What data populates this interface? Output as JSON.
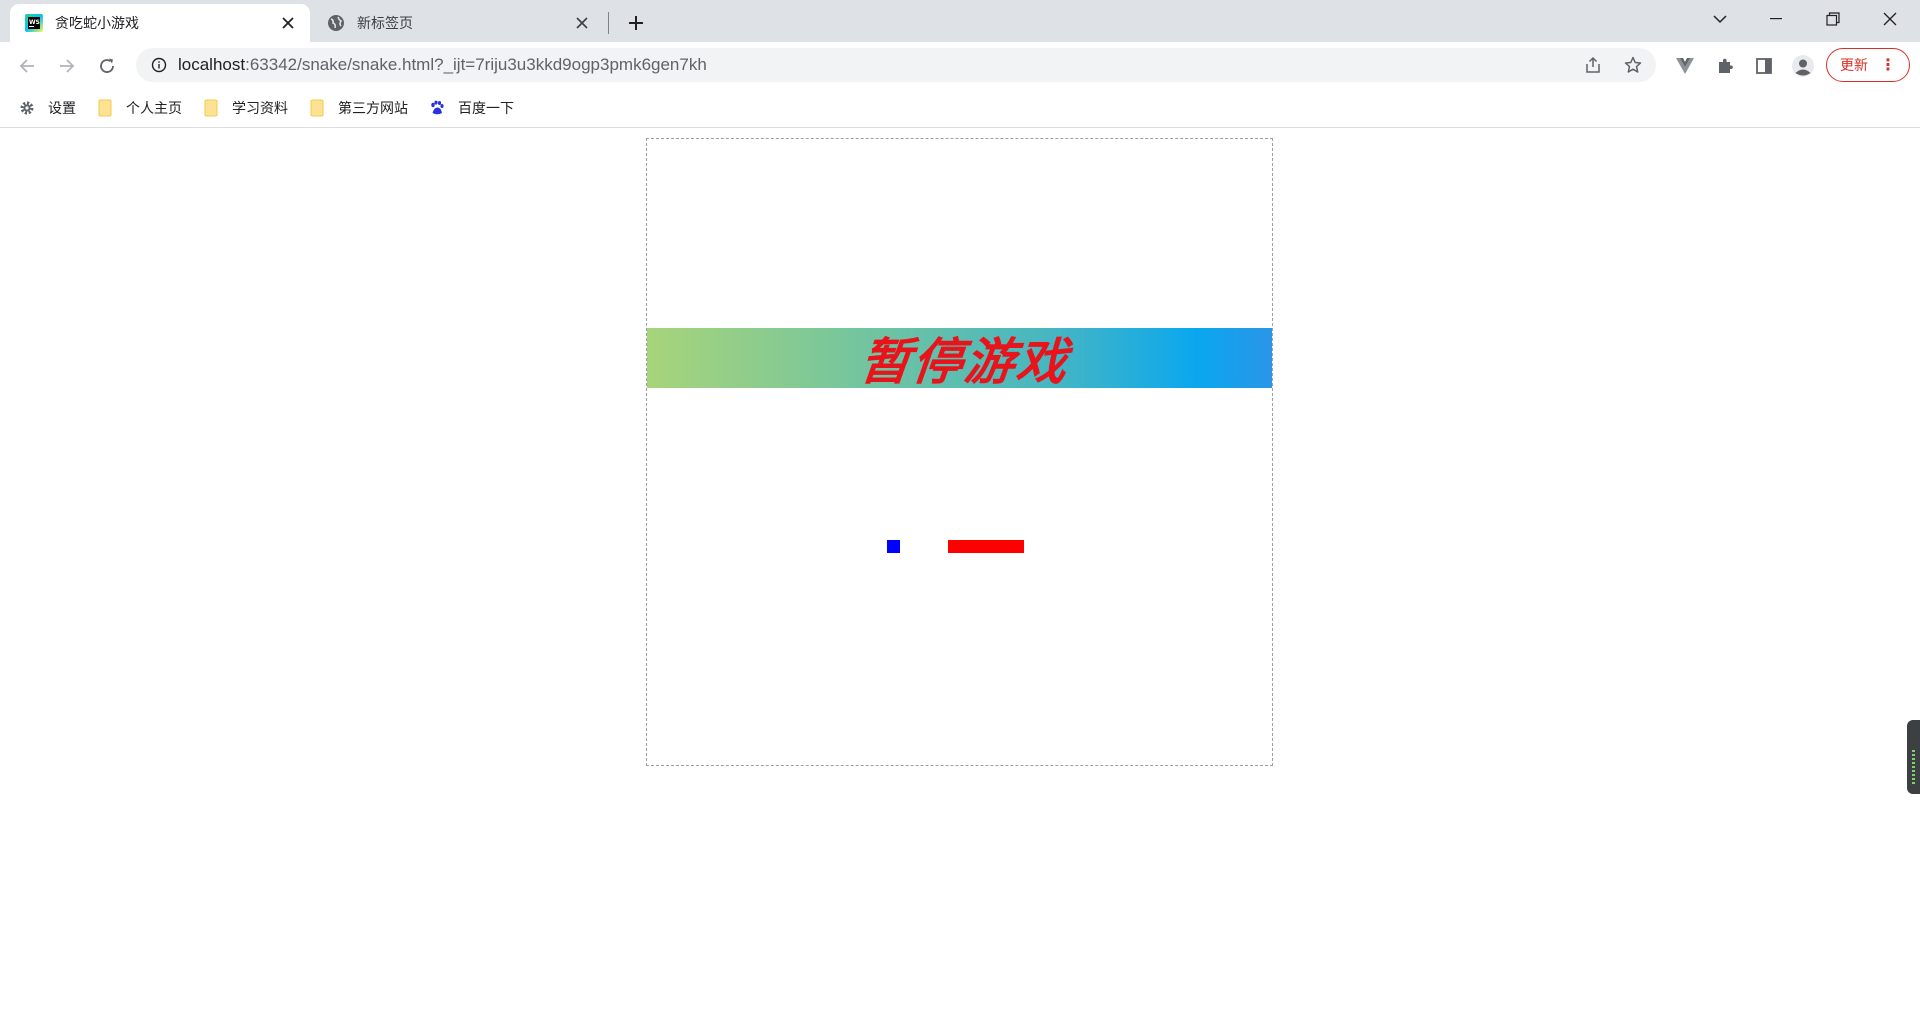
{
  "browser": {
    "tabs": [
      {
        "title": "贪吃蛇小游戏",
        "active": true,
        "icon": "webstorm-icon"
      },
      {
        "title": "新标签页",
        "active": false,
        "icon": "globe-icon"
      }
    ],
    "url": {
      "host": "localhost",
      "rest": ":63342/snake/snake.html?_ijt=7riju3u3kkd9ogp3pmk6gen7kh"
    },
    "update_label": "更新",
    "bookmarks": [
      {
        "label": "设置",
        "icon": "gear-icon"
      },
      {
        "label": "个人主页",
        "icon": "folder-icon"
      },
      {
        "label": "学习资料",
        "icon": "folder-icon"
      },
      {
        "label": "第三方网站",
        "icon": "folder-icon"
      },
      {
        "label": "百度一下",
        "icon": "baidu-paw-icon"
      }
    ]
  },
  "game": {
    "banner_text": "暂停游戏",
    "colors": {
      "food": "#0000ff",
      "snake": "#ff0000",
      "banner_text": "#e8141c",
      "banner_gradient_start": "#a8d47a",
      "banner_gradient_end": "#2b95e8"
    },
    "snake_length_segments": 6
  }
}
